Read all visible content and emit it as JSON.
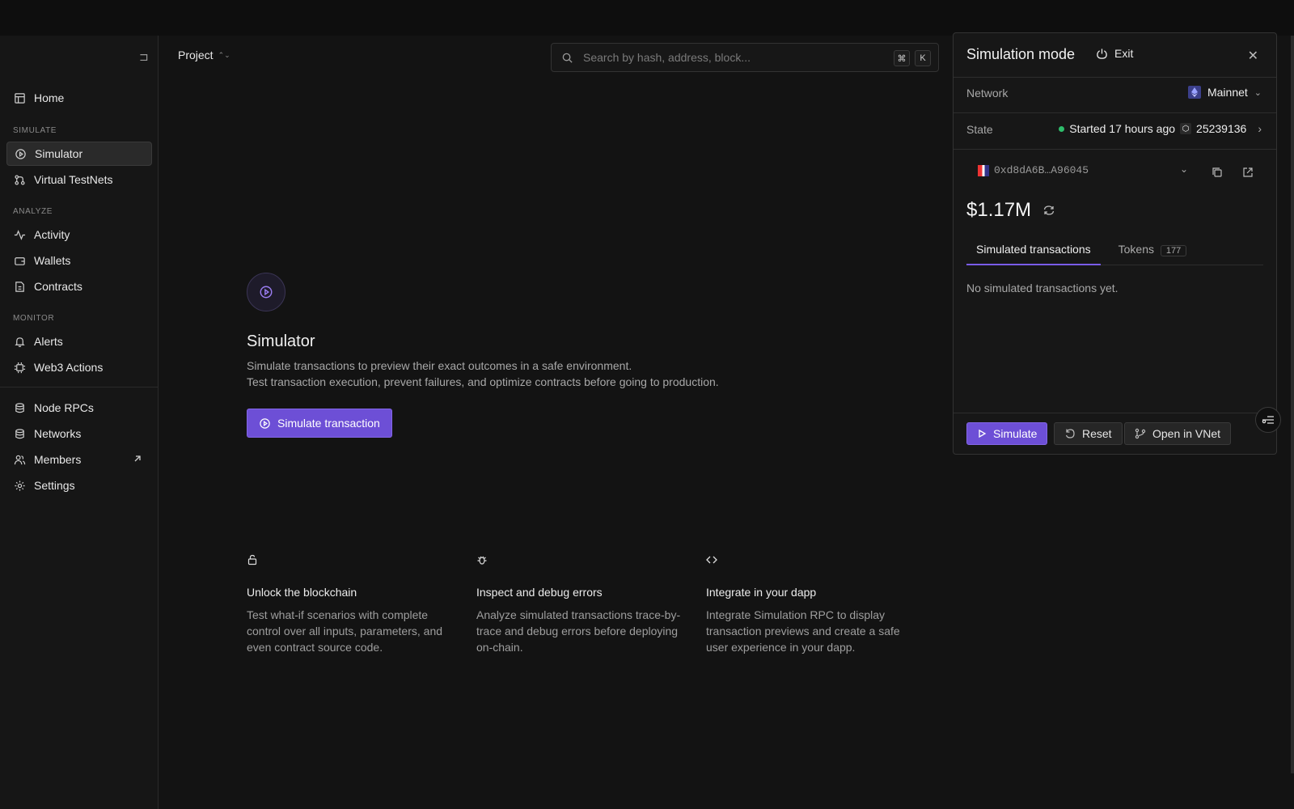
{
  "sidebar": {
    "items": [
      {
        "label": "Home",
        "icon": "table-icon"
      },
      {
        "label": "Simulator",
        "icon": "play-circle-icon"
      },
      {
        "label": "Virtual TestNets",
        "icon": "git-branch-icon"
      },
      {
        "label": "Activity",
        "icon": "activity-icon"
      },
      {
        "label": "Wallets",
        "icon": "wallet-icon"
      },
      {
        "label": "Contracts",
        "icon": "file-icon"
      },
      {
        "label": "Alerts",
        "icon": "bell-icon"
      },
      {
        "label": "Web3 Actions",
        "icon": "cpu-icon"
      },
      {
        "label": "Node RPCs",
        "icon": "database-icon"
      },
      {
        "label": "Networks",
        "icon": "database-icon"
      },
      {
        "label": "Members",
        "icon": "users-icon"
      },
      {
        "label": "Settings",
        "icon": "gear-icon"
      }
    ],
    "sections": {
      "simulate": "SIMULATE",
      "analyze": "ANALYZE",
      "monitor": "MONITOR"
    }
  },
  "header": {
    "project": "Project",
    "search_placeholder": "Search by hash, address, block...",
    "shortcut_cmd": "⌘",
    "shortcut_key": "K"
  },
  "main": {
    "title": "Simulator",
    "desc1": "Simulate transactions to preview their exact outcomes in a safe environment.",
    "desc2": "Test transaction execution, prevent failures, and optimize contracts before going to production.",
    "cta": "Simulate transaction",
    "features": [
      {
        "title": "Unlock the blockchain",
        "desc": "Test what-if scenarios with complete control over all inputs, parameters, and even contract source code."
      },
      {
        "title": "Inspect and debug errors",
        "desc": "Analyze simulated transactions trace-by-trace and debug errors before deploying on-chain."
      },
      {
        "title": "Integrate in your dapp",
        "desc": "Integrate Simulation RPC to display transaction previews and create a safe user experience in your dapp."
      }
    ]
  },
  "sim_panel": {
    "title": "Simulation mode",
    "exit": "Exit",
    "network_label": "Network",
    "network_value": "Mainnet",
    "state_label": "State",
    "state_value": "Started 17 hours ago",
    "block": "25239136",
    "address": "0xd8dA6B…A96045",
    "balance": "$1.17M",
    "tab_simulated": "Simulated transactions",
    "tab_tokens": "Tokens",
    "tokens_count": "177",
    "empty": "No simulated transactions yet.",
    "btn_simulate": "Simulate",
    "btn_reset": "Reset",
    "btn_open": "Open in VNet"
  },
  "colors": {
    "accent": "#6d4fd6",
    "success": "#2ebd6b",
    "background": "#131313"
  }
}
